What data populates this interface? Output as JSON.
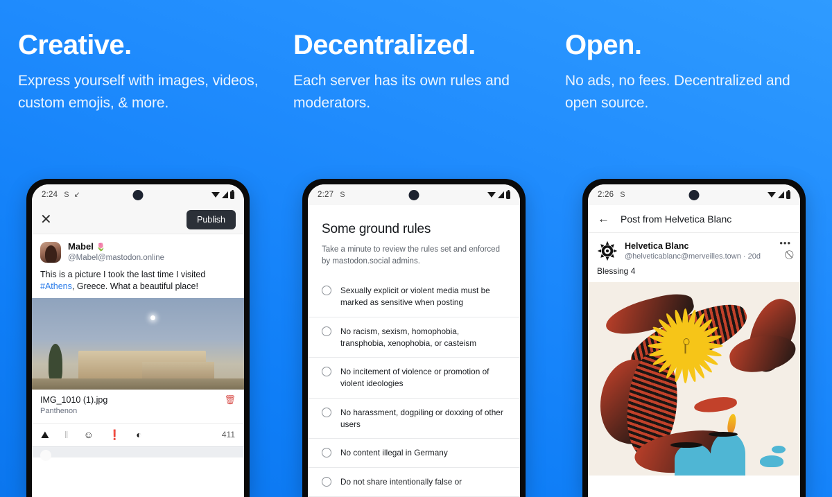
{
  "columns": [
    {
      "heading": "Creative.",
      "subheading": "Express yourself with images, videos, custom emojis, & more."
    },
    {
      "heading": "Decentralized.",
      "subheading": "Each server has its own rules and moderators."
    },
    {
      "heading": "Open.",
      "subheading": "No ads, no fees. Decentralized and open source."
    }
  ],
  "phone1": {
    "status": {
      "time": "2:24",
      "glyph_sync": "S",
      "glyph_download": "↙"
    },
    "close_label": "✕",
    "publish_label": "Publish",
    "account": {
      "name": "Mabel",
      "emoji": "🌷",
      "handle": "@Mabel@mastodon.online"
    },
    "post_text_before": "This is a picture I took the last time I visited ",
    "hashtag": "#Athens",
    "post_text_after": ", Greece. What a beautiful place!",
    "attachment": {
      "filename": "IMG_1010 (1).jpg",
      "description": "Panthenon",
      "delete_icon": "🗑"
    },
    "toolbar": {
      "image_icon": "⛰",
      "poll_icon": "‖",
      "emoji_icon": "☺",
      "warning_icon": "❗",
      "visibility_icon": "◐",
      "char_count": "411"
    }
  },
  "phone2": {
    "status": {
      "time": "2:27",
      "glyph_sync": "S"
    },
    "title": "Some ground rules",
    "subtitle": "Take a minute to review the rules set and enforced by mastodon.social admins.",
    "rules": [
      "Sexually explicit or violent media must be marked as sensitive when posting",
      "No racism, sexism, homophobia, transphobia, xenophobia, or casteism",
      "No incitement of violence or promotion of violent ideologies",
      "No harassment, dogpiling or doxxing of other users",
      "No content illegal in Germany",
      "Do not share intentionally false or"
    ]
  },
  "phone3": {
    "status": {
      "time": "2:26",
      "glyph_sync": "S"
    },
    "back_icon": "←",
    "title": "Post from Helvetica Blanc",
    "account": {
      "name": "Helvetica Blanc",
      "handle": "@helveticablanc@merveilles.town · 20d"
    },
    "menu_icon": "•••",
    "hide_icon": "⃠",
    "body": "Blessing 4"
  },
  "colors": {
    "background_blue": "#1f8bfd",
    "publish_dark": "#2b3038",
    "hashtag_blue": "#2b7ce9",
    "trash_red": "#d9534f",
    "artwork_cream": "#f4eee6",
    "artwork_sun": "#f6c518",
    "artwork_red": "#c2412a",
    "artwork_teal": "#4fb6d4"
  }
}
